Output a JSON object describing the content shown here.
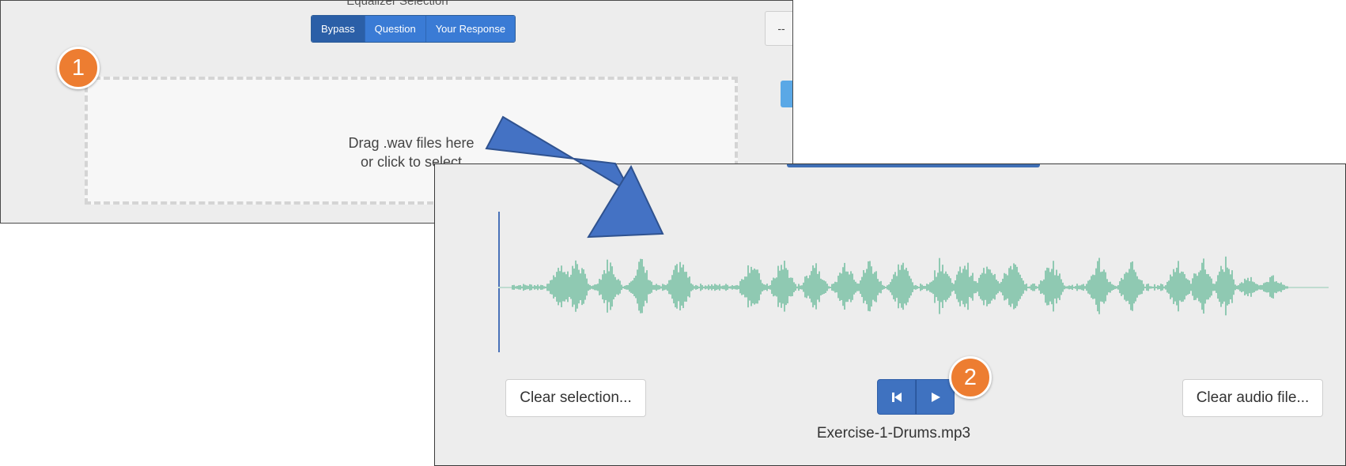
{
  "shot1": {
    "title": "Equalizer Selection",
    "tabs": [
      {
        "label": "Bypass",
        "active": true
      },
      {
        "label": "Question",
        "active": false
      },
      {
        "label": "Your Response",
        "active": false
      }
    ],
    "right_button_label": "--",
    "dropzone": {
      "line1": "Drag .wav files here",
      "line2": "or click to select"
    }
  },
  "callouts": {
    "step1": "1",
    "step2": "2"
  },
  "shot2": {
    "clear_selection_label": "Clear selection...",
    "clear_audio_label": "Clear audio file...",
    "filename": "Exercise-1-Drums.mp3",
    "controls": [
      "skip-to-start-icon",
      "play-icon"
    ]
  },
  "colors": {
    "accent_blue": "#3a7bd5",
    "callout_orange": "#ed7d31",
    "waveform": "#8fc9b2",
    "arrow": "#4472c4"
  }
}
